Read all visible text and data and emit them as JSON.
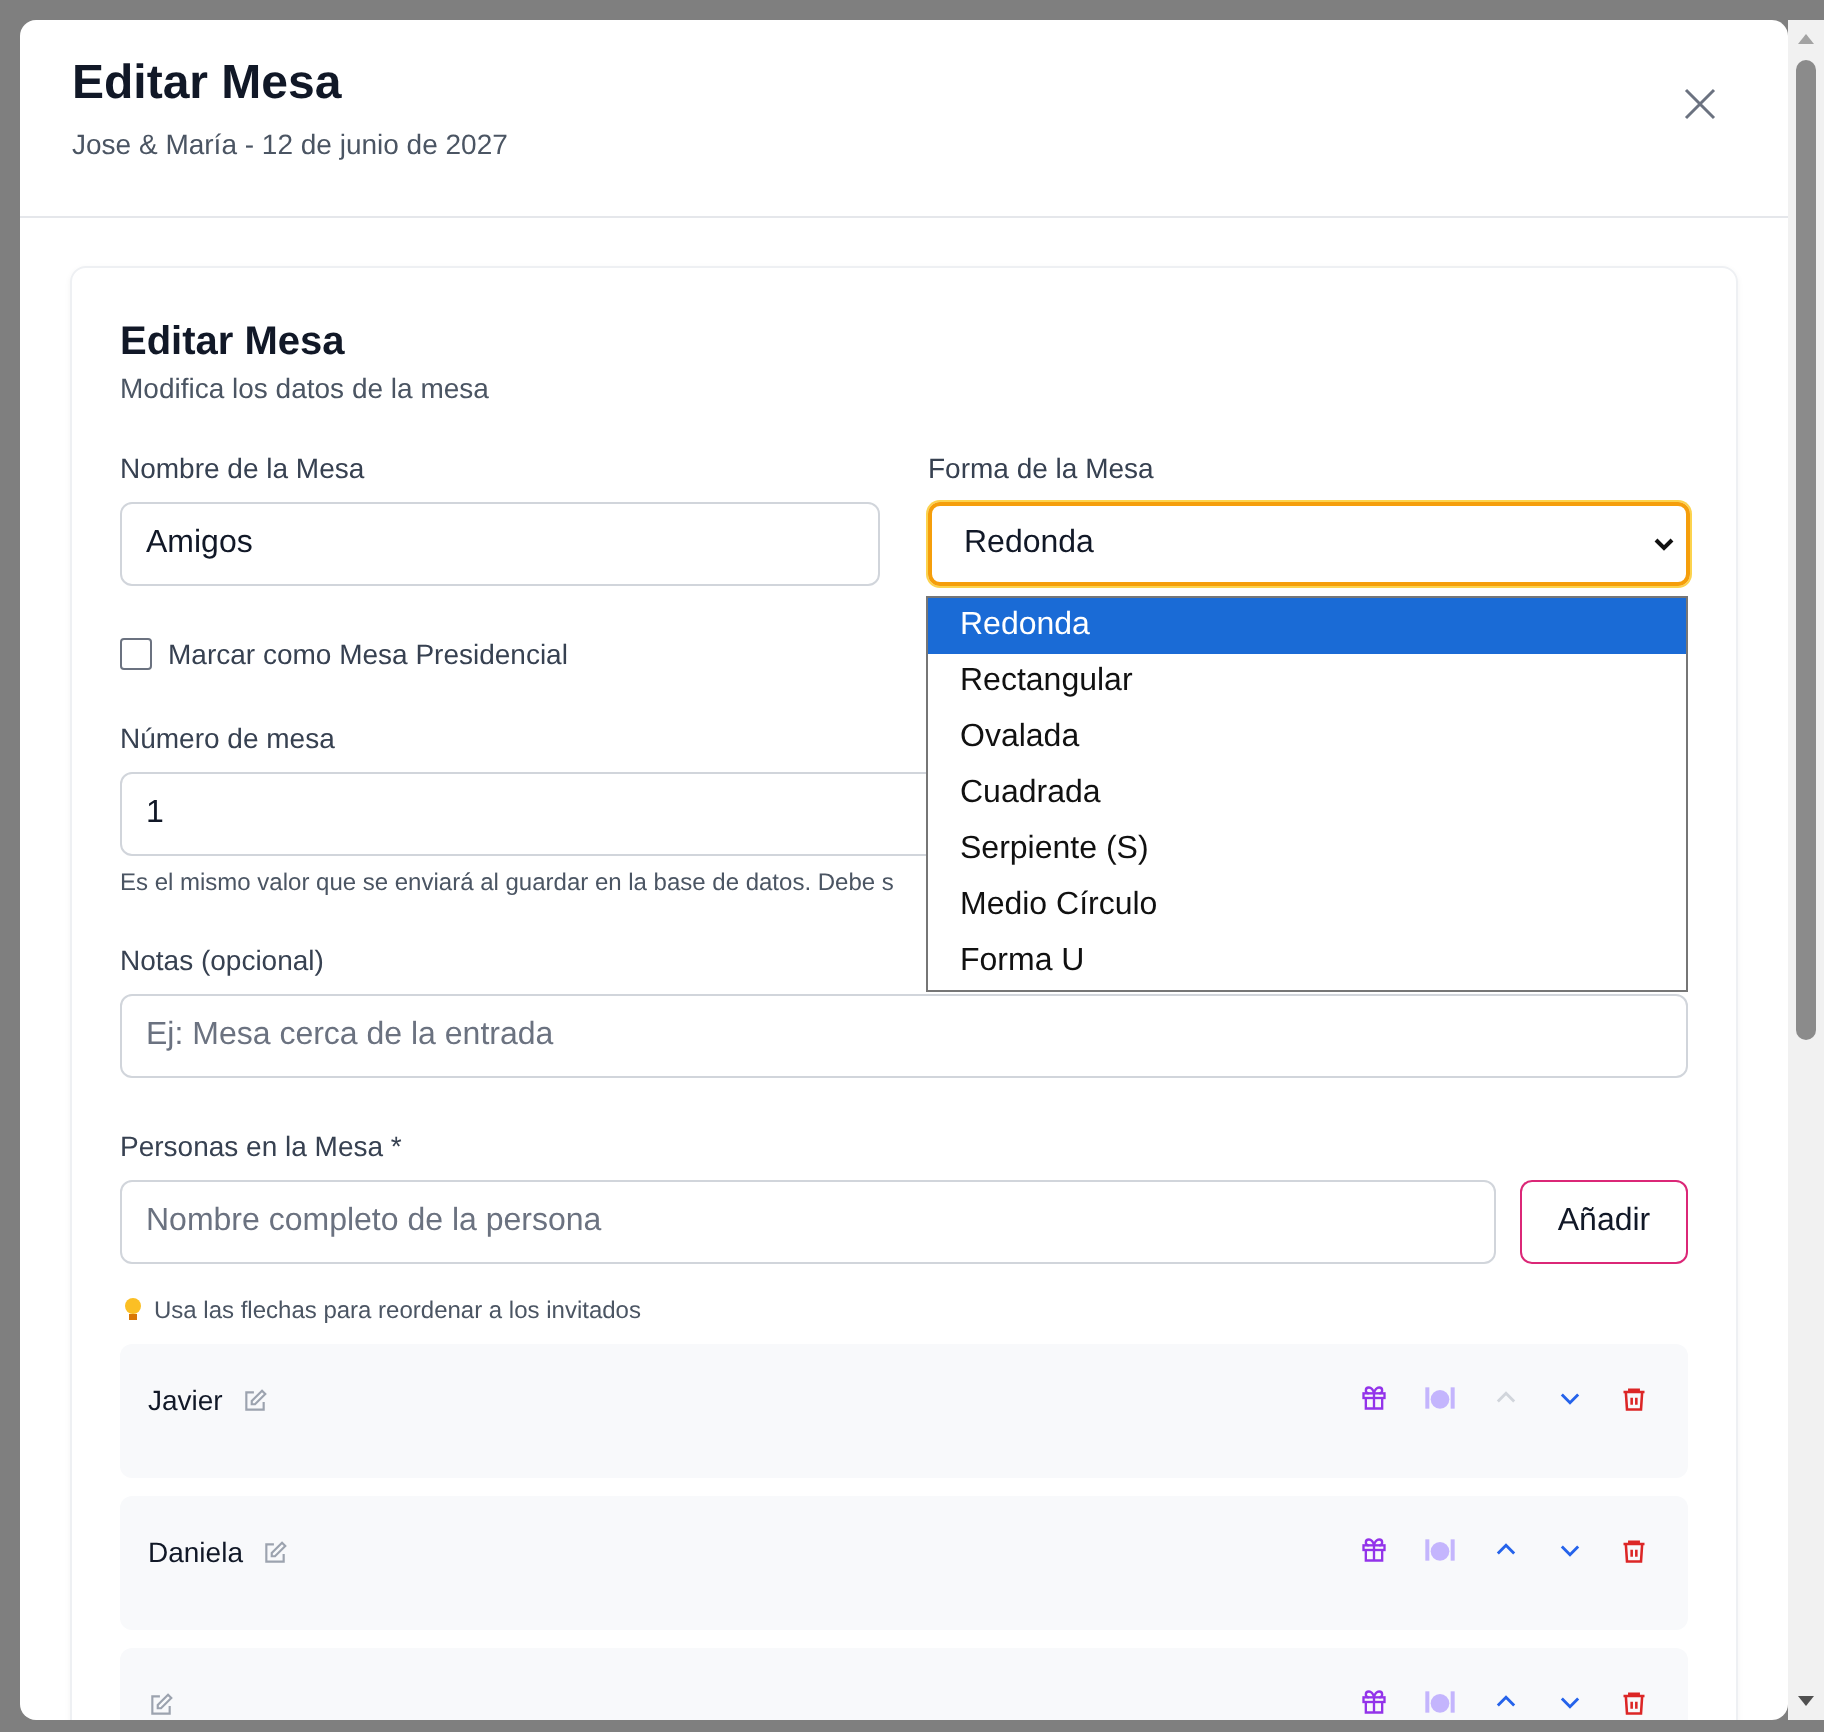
{
  "modal": {
    "title": "Editar Mesa",
    "subtitle": "Jose & María - 12 de junio de 2027"
  },
  "card": {
    "title": "Editar Mesa",
    "description": "Modifica los datos de la mesa"
  },
  "name_field": {
    "label": "Nombre de la Mesa",
    "value": "Amigos"
  },
  "shape_field": {
    "label": "Forma de la Mesa",
    "value": "Redonda",
    "expanded": true,
    "options": [
      {
        "label": "Redonda",
        "selected": true
      },
      {
        "label": "Rectangular",
        "selected": false
      },
      {
        "label": "Ovalada",
        "selected": false
      },
      {
        "label": "Cuadrada",
        "selected": false
      },
      {
        "label": "Serpiente (S)",
        "selected": false
      },
      {
        "label": "Medio Círculo",
        "selected": false
      },
      {
        "label": "Forma U",
        "selected": false
      }
    ]
  },
  "presidential": {
    "label": "Marcar como Mesa Presidencial",
    "checked": false
  },
  "number_field": {
    "label": "Número de mesa",
    "value": "1",
    "hint": "Es el mismo valor que se enviará al guardar en la base de datos. Debe s"
  },
  "notes_field": {
    "label": "Notas (opcional)",
    "placeholder": "Ej: Mesa cerca de la entrada"
  },
  "people": {
    "label": "Personas en la Mesa *",
    "placeholder": "Nombre completo de la persona",
    "add_button": "Añadir",
    "tip": "Usa las flechas para reordenar a los invitados",
    "guests": [
      {
        "name": "Javier",
        "can_move_up": false
      },
      {
        "name": "Daniela",
        "can_move_up": true
      },
      {
        "can_move_up": true
      }
    ]
  }
}
